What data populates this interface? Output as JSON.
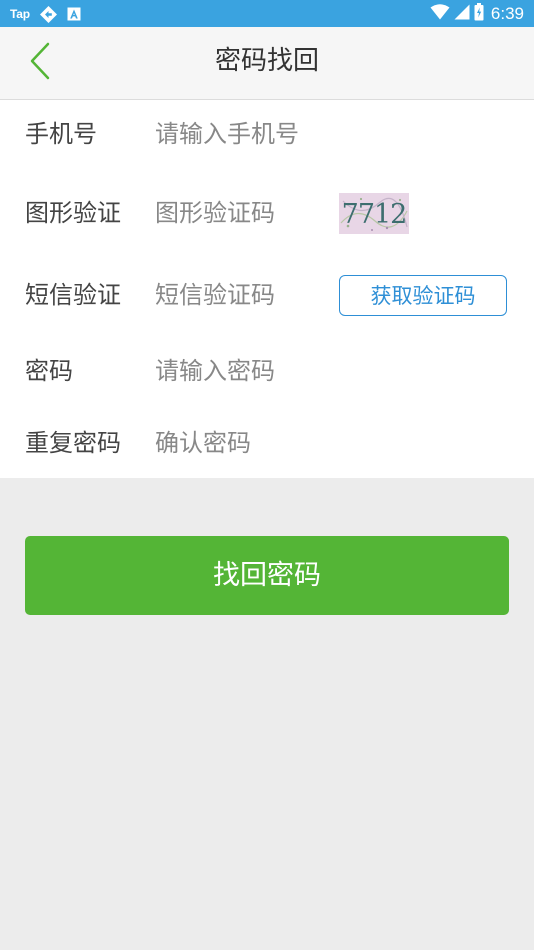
{
  "status_bar": {
    "app_label": "Tap",
    "time": "6:39",
    "background": "#3aa3e0",
    "icons": [
      "app-sync-icon",
      "a-icon",
      "wifi-icon",
      "signal-icon",
      "battery-icon"
    ]
  },
  "header": {
    "title": "密码找回",
    "back_icon": "chevron-left-icon",
    "accent": "#54b536"
  },
  "form": {
    "phone": {
      "label": "手机号",
      "placeholder": "请输入手机号",
      "value": ""
    },
    "captcha": {
      "label": "图形验证",
      "placeholder": "图形验证码",
      "value": "",
      "image_text": "7712"
    },
    "sms": {
      "label": "短信验证",
      "placeholder": "短信验证码",
      "value": "",
      "button": "获取验证码"
    },
    "password": {
      "label": "密码",
      "placeholder": "请输入密码",
      "value": ""
    },
    "confirm": {
      "label": "重复密码",
      "placeholder": "确认密码",
      "value": ""
    }
  },
  "submit": {
    "label": "找回密码",
    "color": "#54b536"
  },
  "colors": {
    "link_blue": "#2e8fd6",
    "page_bg": "#ececec"
  }
}
